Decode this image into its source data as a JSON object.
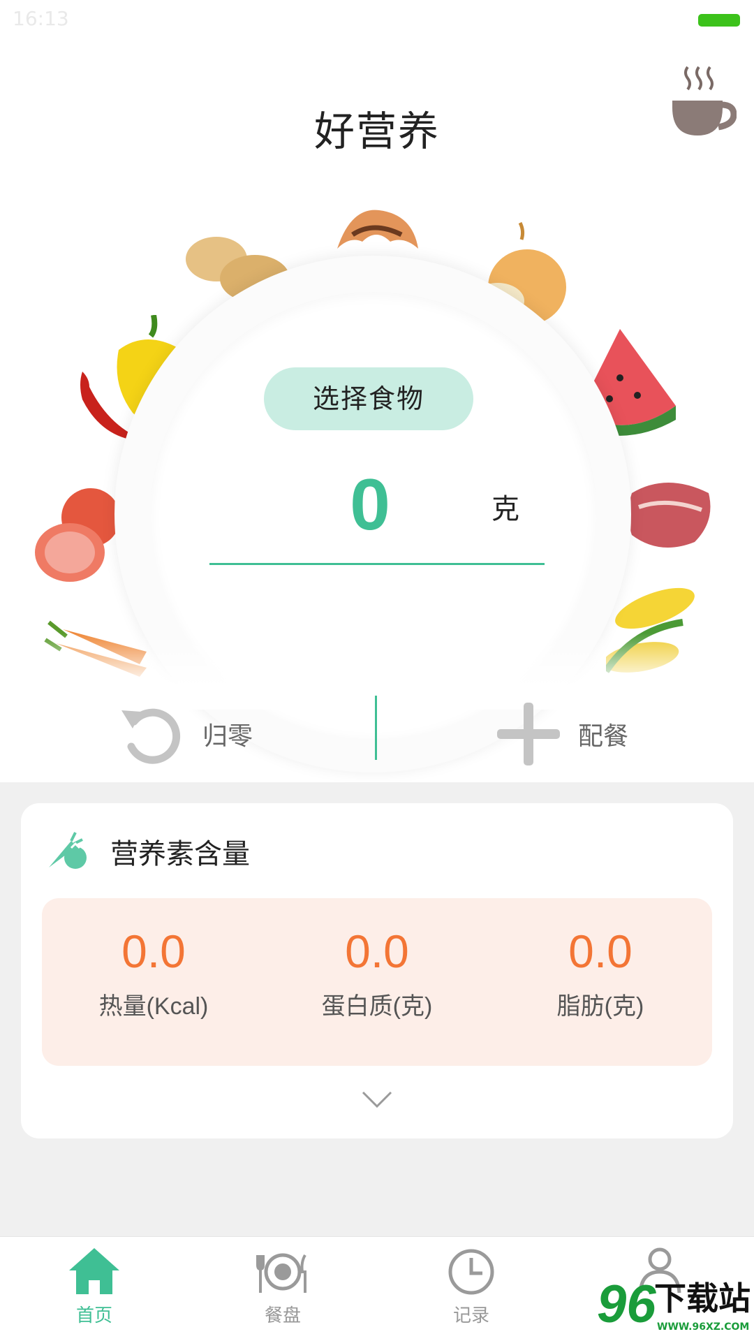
{
  "status_bar": {
    "faint_time": "16:13"
  },
  "header": {
    "title": "好营养",
    "icon": "coffee-cup-icon"
  },
  "scale": {
    "choose_label": "选择食物",
    "weight_value": "0",
    "weight_unit": "克"
  },
  "actions": {
    "reset": {
      "label": "归零",
      "icon": "reset-icon"
    },
    "combo": {
      "label": "配餐",
      "icon": "plus-icon"
    }
  },
  "nutrients": {
    "title": "营养素含量",
    "icon": "carrot-tomato-icon",
    "items": [
      {
        "value": "0.0",
        "label": "热量(Kcal)"
      },
      {
        "value": "0.0",
        "label": "蛋白质(克)"
      },
      {
        "value": "0.0",
        "label": "脂肪(克)"
      }
    ]
  },
  "tabs": [
    {
      "label": "首页",
      "icon": "home-icon",
      "active": true
    },
    {
      "label": "餐盘",
      "icon": "plate-icon",
      "active": false
    },
    {
      "label": "记录",
      "icon": "clock-icon",
      "active": false
    },
    {
      "label": "",
      "icon": "user-icon",
      "active": false
    }
  ],
  "watermark": {
    "number": "96",
    "text": "下载站",
    "url": "WWW.96XZ.COM"
  },
  "colors": {
    "accent": "#3fbf94",
    "nutrient_value": "#f37535",
    "nutrient_bg": "#fdeee8"
  }
}
